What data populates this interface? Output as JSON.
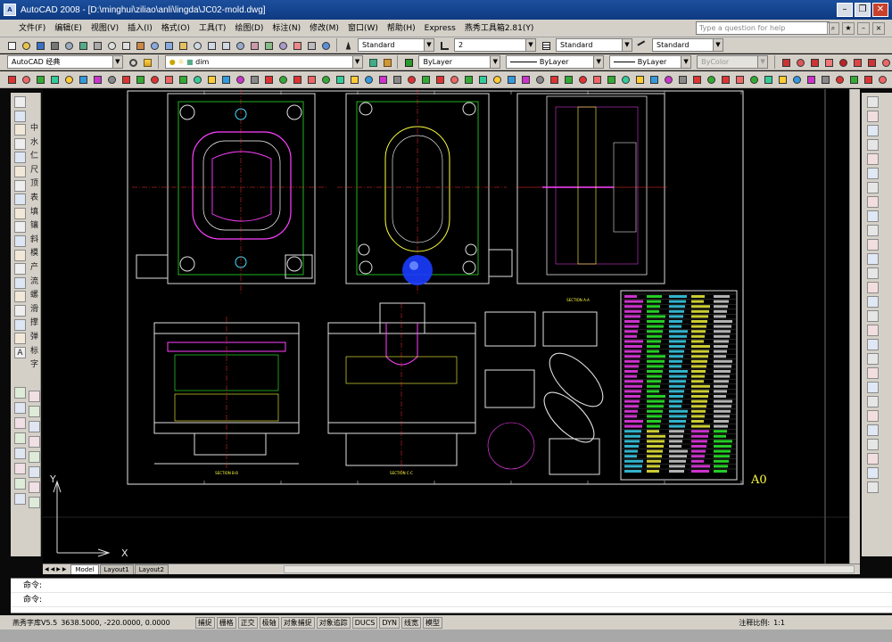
{
  "window": {
    "title": "AutoCAD 2008 - [D:\\minghui\\ziliao\\anli\\lingda\\JC02-mold.dwg]",
    "app_icon_text": "A"
  },
  "menu": {
    "items": [
      "文件(F)",
      "编辑(E)",
      "视图(V)",
      "插入(I)",
      "格式(O)",
      "工具(T)",
      "绘图(D)",
      "标注(N)",
      "修改(M)",
      "窗口(W)",
      "帮助(H)",
      "Express",
      "燕秀工具箱2.81(Y)"
    ],
    "help_placeholder": "Type a question for help"
  },
  "styles_toolbar": {
    "text_style": "Standard",
    "dim_style": "2",
    "table_style": "Standard",
    "mleader_style": "Standard"
  },
  "layers_toolbar": {
    "workspace": "AutoCAD 经典",
    "layer": "dim",
    "color": "ByLayer",
    "linetype": "ByLayer",
    "lineweight": "ByLayer",
    "plotstyle": "ByColor"
  },
  "left_toolbar": {
    "labels": [
      "中",
      "水",
      "仁",
      "尺",
      "顶",
      "表",
      "填",
      "镶",
      "斜",
      "模",
      "产",
      "流",
      "螺",
      "滑",
      "撑",
      "弹",
      "标",
      "字"
    ]
  },
  "drawing": {
    "sheet_label": "A0",
    "view_titles": [
      "SECTION B-B",
      "SECTION C-C",
      "SECTION A-A"
    ],
    "ucs_x": "X",
    "ucs_y": "Y"
  },
  "layout_tabs": [
    "Model",
    "Layout1",
    "Layout2"
  ],
  "command": {
    "line1_prompt": "命令:",
    "line2_prompt": "命令:"
  },
  "status": {
    "coords_label": "燕秀字库V5.5",
    "coords": "3638.5000, -220.0000, 0.0000",
    "toggles": [
      "捕捉",
      "栅格",
      "正交",
      "极轴",
      "对象捕捉",
      "对象追踪",
      "DUCS",
      "DYN",
      "线宽",
      "模型"
    ],
    "annotation_scale_label": "注释比例:",
    "annotation_scale": "1:1"
  },
  "colors": {
    "title_bar": "#1c4f9c",
    "toolbar_bg": "#d4d0c8",
    "canvas_bg": "#000000",
    "drawing_magenta": "#ff40ff",
    "drawing_green": "#30ff30",
    "drawing_cyan": "#40e0ff",
    "drawing_yellow": "#ffff40",
    "cursor_blue": "#1a3cff"
  }
}
